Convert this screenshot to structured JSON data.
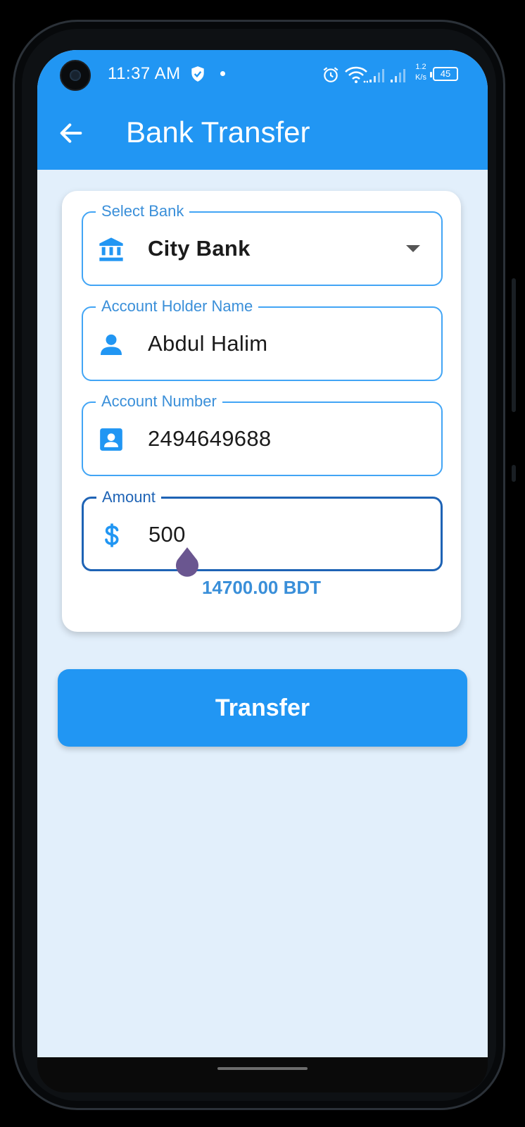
{
  "status_bar": {
    "time": "11:37 AM",
    "net_speed_value": "1.2",
    "net_speed_unit": "K/s",
    "battery": "45"
  },
  "app_bar": {
    "title": "Bank Transfer",
    "back_icon": "arrow-back-icon"
  },
  "form": {
    "bank": {
      "label": "Select Bank",
      "value": "City Bank",
      "icon": "bank-icon"
    },
    "holder": {
      "label": "Account Holder Name",
      "value": "Abdul Halim",
      "icon": "person-icon"
    },
    "account": {
      "label": "Account Number",
      "value": "2494649688",
      "icon": "contact-card-icon"
    },
    "amount": {
      "label": "Amount",
      "value": "500",
      "icon": "dollar-icon"
    },
    "balance": "14700.00 BDT"
  },
  "actions": {
    "transfer_label": "Transfer"
  },
  "colors": {
    "primary": "#2196f3",
    "background": "#e2effb",
    "field_border": "#42a5f5",
    "focused_border": "#1e63b5",
    "accent_text": "#3a8fd9",
    "cursor_handle": "#6a5690"
  }
}
